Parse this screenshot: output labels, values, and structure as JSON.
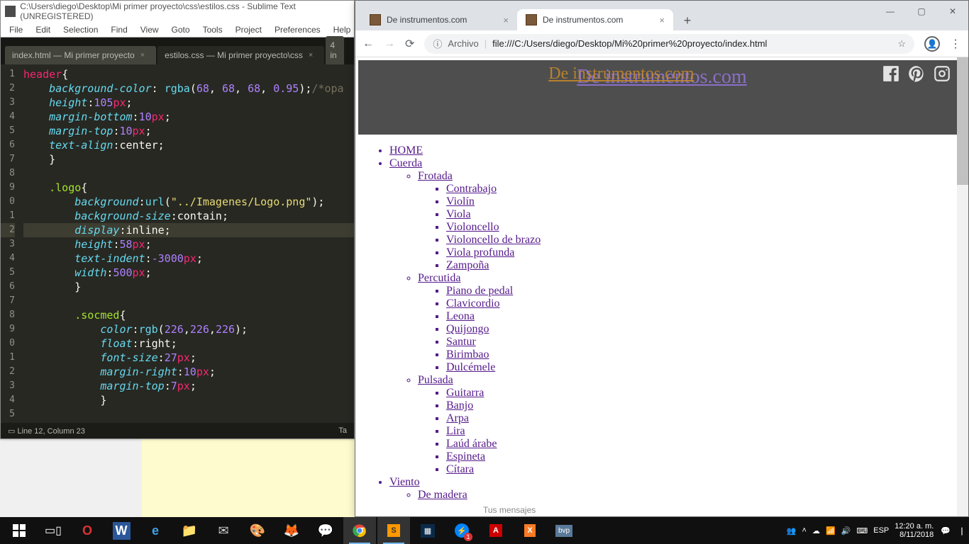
{
  "sublime": {
    "title": "C:\\Users\\diego\\Desktop\\Mi primer proyecto\\css\\estilos.css - Sublime Text (UNREGISTERED)",
    "menubar": [
      "File",
      "Edit",
      "Selection",
      "Find",
      "View",
      "Goto",
      "Tools",
      "Project",
      "Preferences",
      "Help"
    ],
    "tabs": [
      {
        "label": "index.html — Mi primer proyecto",
        "active": false
      },
      {
        "label": "estilos.css — Mi primer proyecto\\css",
        "active": true
      }
    ],
    "status_left": "Line 12, Column 23",
    "status_right": "Ta",
    "line_numbers": [
      "1",
      "2",
      "3",
      "4",
      "5",
      "6",
      "7",
      "8",
      "9",
      "0",
      "1",
      "2",
      "3",
      "4",
      "5",
      "6",
      "7",
      "8",
      "9",
      "0",
      "1",
      "2",
      "3",
      "4",
      "5"
    ],
    "highlight_line_index": 11,
    "code": [
      [
        {
          "c": "tok-tag",
          "t": "header"
        },
        {
          "c": "tok-punc",
          "t": "{"
        }
      ],
      [
        {
          "c": "",
          "t": "    "
        },
        {
          "c": "tok-prop",
          "t": "background-color"
        },
        {
          "c": "tok-punc",
          "t": ": "
        },
        {
          "c": "tok-func",
          "t": "rgba"
        },
        {
          "c": "tok-punc",
          "t": "("
        },
        {
          "c": "tok-num",
          "t": "68"
        },
        {
          "c": "tok-punc",
          "t": ", "
        },
        {
          "c": "tok-num",
          "t": "68"
        },
        {
          "c": "tok-punc",
          "t": ", "
        },
        {
          "c": "tok-num",
          "t": "68"
        },
        {
          "c": "tok-punc",
          "t": ", "
        },
        {
          "c": "tok-num",
          "t": "0.95"
        },
        {
          "c": "tok-punc",
          "t": ");"
        },
        {
          "c": "tok-comm",
          "t": "/*opa"
        }
      ],
      [
        {
          "c": "",
          "t": "    "
        },
        {
          "c": "tok-prop",
          "t": "height"
        },
        {
          "c": "tok-punc",
          "t": ":"
        },
        {
          "c": "tok-num",
          "t": "105"
        },
        {
          "c": "tok-unit",
          "t": "px"
        },
        {
          "c": "tok-punc",
          "t": ";"
        }
      ],
      [
        {
          "c": "",
          "t": "    "
        },
        {
          "c": "tok-prop",
          "t": "margin-bottom"
        },
        {
          "c": "tok-punc",
          "t": ":"
        },
        {
          "c": "tok-num",
          "t": "10"
        },
        {
          "c": "tok-unit",
          "t": "px"
        },
        {
          "c": "tok-punc",
          "t": ";"
        }
      ],
      [
        {
          "c": "",
          "t": "    "
        },
        {
          "c": "tok-prop",
          "t": "margin-top"
        },
        {
          "c": "tok-punc",
          "t": ":"
        },
        {
          "c": "tok-num",
          "t": "10"
        },
        {
          "c": "tok-unit",
          "t": "px"
        },
        {
          "c": "tok-punc",
          "t": ";"
        }
      ],
      [
        {
          "c": "",
          "t": "    "
        },
        {
          "c": "tok-prop",
          "t": "text-align"
        },
        {
          "c": "tok-punc",
          "t": ":center;"
        }
      ],
      [
        {
          "c": "",
          "t": "    "
        },
        {
          "c": "tok-punc",
          "t": "}"
        }
      ],
      [],
      [
        {
          "c": "",
          "t": "    "
        },
        {
          "c": "tok-sel",
          "t": ".logo"
        },
        {
          "c": "tok-punc",
          "t": "{"
        }
      ],
      [
        {
          "c": "",
          "t": "        "
        },
        {
          "c": "tok-prop",
          "t": "background"
        },
        {
          "c": "tok-punc",
          "t": ":"
        },
        {
          "c": "tok-func",
          "t": "url"
        },
        {
          "c": "tok-punc",
          "t": "("
        },
        {
          "c": "tok-str",
          "t": "\"../Imagenes/Logo.png\""
        },
        {
          "c": "tok-punc",
          "t": ");"
        }
      ],
      [
        {
          "c": "",
          "t": "        "
        },
        {
          "c": "tok-prop",
          "t": "background-size"
        },
        {
          "c": "tok-punc",
          "t": ":contain;"
        }
      ],
      [
        {
          "c": "",
          "t": "        "
        },
        {
          "c": "tok-prop",
          "t": "display"
        },
        {
          "c": "tok-punc",
          "t": ":inline;"
        }
      ],
      [
        {
          "c": "",
          "t": "        "
        },
        {
          "c": "tok-prop",
          "t": "height"
        },
        {
          "c": "tok-punc",
          "t": ":"
        },
        {
          "c": "tok-num",
          "t": "58"
        },
        {
          "c": "tok-unit",
          "t": "px"
        },
        {
          "c": "tok-punc",
          "t": ";"
        }
      ],
      [
        {
          "c": "",
          "t": "        "
        },
        {
          "c": "tok-prop",
          "t": "text-indent"
        },
        {
          "c": "tok-punc",
          "t": ":"
        },
        {
          "c": "tok-num",
          "t": "-3000"
        },
        {
          "c": "tok-unit",
          "t": "px"
        },
        {
          "c": "tok-punc",
          "t": ";"
        }
      ],
      [
        {
          "c": "",
          "t": "        "
        },
        {
          "c": "tok-prop",
          "t": "width"
        },
        {
          "c": "tok-punc",
          "t": ":"
        },
        {
          "c": "tok-num",
          "t": "500"
        },
        {
          "c": "tok-unit",
          "t": "px"
        },
        {
          "c": "tok-punc",
          "t": ";"
        }
      ],
      [
        {
          "c": "",
          "t": "        "
        },
        {
          "c": "tok-punc",
          "t": "}"
        }
      ],
      [],
      [
        {
          "c": "",
          "t": "        "
        },
        {
          "c": "tok-sel",
          "t": ".socmed"
        },
        {
          "c": "tok-punc",
          "t": "{"
        }
      ],
      [
        {
          "c": "",
          "t": "            "
        },
        {
          "c": "tok-prop",
          "t": "color"
        },
        {
          "c": "tok-punc",
          "t": ":"
        },
        {
          "c": "tok-func",
          "t": "rgb"
        },
        {
          "c": "tok-punc",
          "t": "("
        },
        {
          "c": "tok-num",
          "t": "226"
        },
        {
          "c": "tok-punc",
          "t": ","
        },
        {
          "c": "tok-num",
          "t": "226"
        },
        {
          "c": "tok-punc",
          "t": ","
        },
        {
          "c": "tok-num",
          "t": "226"
        },
        {
          "c": "tok-punc",
          "t": ");"
        }
      ],
      [
        {
          "c": "",
          "t": "            "
        },
        {
          "c": "tok-prop",
          "t": "float"
        },
        {
          "c": "tok-punc",
          "t": ":right;"
        }
      ],
      [
        {
          "c": "",
          "t": "            "
        },
        {
          "c": "tok-prop",
          "t": "font-size"
        },
        {
          "c": "tok-punc",
          "t": ":"
        },
        {
          "c": "tok-num",
          "t": "27"
        },
        {
          "c": "tok-unit",
          "t": "px"
        },
        {
          "c": "tok-punc",
          "t": ";"
        }
      ],
      [
        {
          "c": "",
          "t": "            "
        },
        {
          "c": "tok-prop",
          "t": "margin-right"
        },
        {
          "c": "tok-punc",
          "t": ":"
        },
        {
          "c": "tok-num",
          "t": "10"
        },
        {
          "c": "tok-unit",
          "t": "px"
        },
        {
          "c": "tok-punc",
          "t": ";"
        }
      ],
      [
        {
          "c": "",
          "t": "            "
        },
        {
          "c": "tok-prop",
          "t": "margin-top"
        },
        {
          "c": "tok-punc",
          "t": ":"
        },
        {
          "c": "tok-num",
          "t": "7"
        },
        {
          "c": "tok-unit",
          "t": "px"
        },
        {
          "c": "tok-punc",
          "t": ";"
        }
      ],
      [
        {
          "c": "",
          "t": "            "
        },
        {
          "c": "tok-punc",
          "t": "}"
        }
      ],
      []
    ]
  },
  "chrome": {
    "tabs": [
      {
        "title": "De instrumentos.com",
        "active": false
      },
      {
        "title": "De instrumentos.com",
        "active": true
      }
    ],
    "url_label_archivo": "Archivo",
    "url_text": "file:///C:/Users/diego/Desktop/Mi%20primer%20proyecto/index.html",
    "page": {
      "logo_text": "De instrumentos.com",
      "nav": [
        {
          "label": "HOME"
        },
        {
          "label": "Cuerda",
          "children": [
            {
              "label": "Frotada",
              "children": [
                {
                  "label": "Contrabajo"
                },
                {
                  "label": "Violín"
                },
                {
                  "label": "Viola"
                },
                {
                  "label": "Violoncello"
                },
                {
                  "label": "Violoncello de brazo"
                },
                {
                  "label": "Viola profunda"
                },
                {
                  "label": "Zampoña"
                }
              ]
            },
            {
              "label": "Percutida",
              "children": [
                {
                  "label": "Piano de pedal"
                },
                {
                  "label": "Clavicordio"
                },
                {
                  "label": "Leona"
                },
                {
                  "label": "Quijongo"
                },
                {
                  "label": "Santur"
                },
                {
                  "label": "Birimbao"
                },
                {
                  "label": "Dulcémele"
                }
              ]
            },
            {
              "label": "Pulsada",
              "children": [
                {
                  "label": "Guitarra"
                },
                {
                  "label": "Banjo"
                },
                {
                  "label": "Arpa"
                },
                {
                  "label": "Lira"
                },
                {
                  "label": "Laúd árabe"
                },
                {
                  "label": "Espineta"
                },
                {
                  "label": "Cítara"
                }
              ]
            }
          ]
        },
        {
          "label": "Viento",
          "children": [
            {
              "label": "De madera"
            }
          ]
        }
      ]
    }
  },
  "taskbar": {
    "messages_hint": "Tus mensajes",
    "tray_text_lang": "ESP",
    "clock": {
      "time": "12:20 a. m.",
      "date": "8/11/2018"
    }
  }
}
